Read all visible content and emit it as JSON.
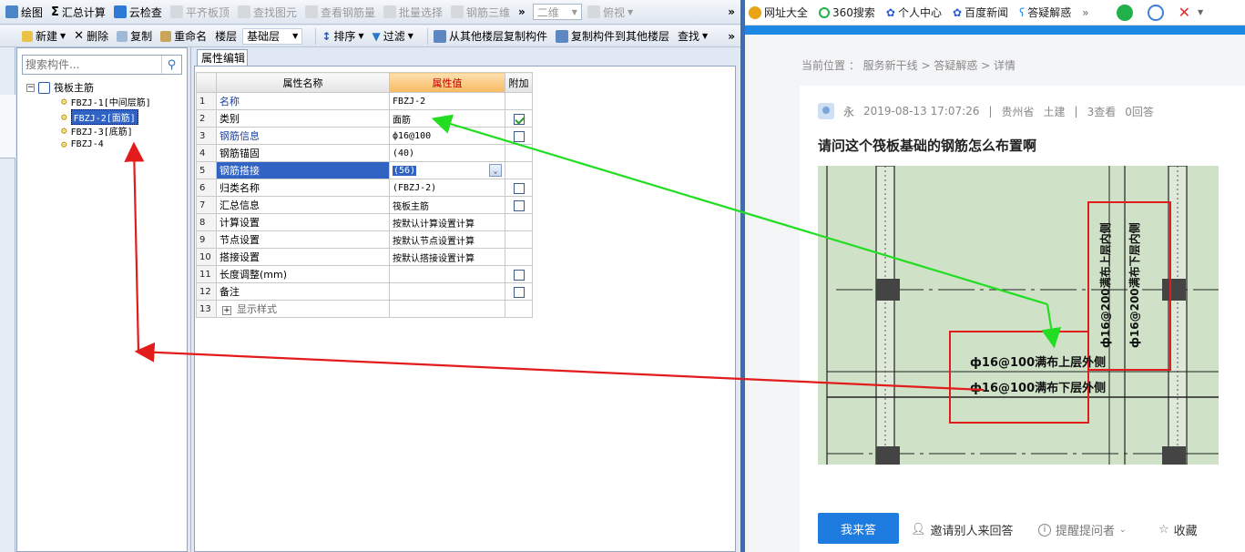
{
  "toolbar1": {
    "items": [
      {
        "label": "绘图",
        "icon": "draw-icon",
        "enabled": true
      },
      {
        "label": "汇总计算",
        "icon": "sigma-icon",
        "enabled": true
      },
      {
        "label": "云检查",
        "icon": "cloud-check-icon",
        "enabled": true
      },
      {
        "label": "平齐板顶",
        "icon": "align-top-icon",
        "enabled": false
      },
      {
        "label": "查找图元",
        "icon": "find-element-icon",
        "enabled": false
      },
      {
        "label": "查看钢筋量",
        "icon": "view-rebar-icon",
        "enabled": false
      },
      {
        "label": "批量选择",
        "icon": "batch-select-icon",
        "enabled": false
      },
      {
        "label": "钢筋三维",
        "icon": "rebar-3d-icon",
        "enabled": false
      }
    ],
    "view_mode": "二维",
    "view_angle": "俯视"
  },
  "toolbar2": {
    "new": "新建",
    "delete": "删除",
    "copy": "复制",
    "rename": "重命名",
    "floor_label": "楼层",
    "floor_value": "基础层",
    "sort": "排序",
    "filter": "过滤",
    "copy_from_other": "从其他楼层复制构件",
    "copy_to_other": "复制构件到其他楼层",
    "find": "查找"
  },
  "tree": {
    "search_placeholder": "搜索构件...",
    "root": "筏板主筋",
    "children": [
      "FBZJ-1[中间层筋]",
      "FBZJ-2[面筋]",
      "FBZJ-3[底筋]",
      "FBZJ-4"
    ],
    "selected_index": 1
  },
  "properties": {
    "tab": "属性编辑",
    "headers": {
      "name": "属性名称",
      "value": "属性值",
      "extra": "附加"
    },
    "rows": [
      {
        "no": "1",
        "name": "名称",
        "value": "FBZJ-2",
        "blue": true,
        "checkbox": null
      },
      {
        "no": "2",
        "name": "类别",
        "value": "面筋",
        "blue": false,
        "checkbox": true
      },
      {
        "no": "3",
        "name": "钢筋信息",
        "value": "ф16@100",
        "blue": true,
        "checkbox": false
      },
      {
        "no": "4",
        "name": "钢筋锚固",
        "value": "(40)",
        "blue": false,
        "checkbox": null
      },
      {
        "no": "5",
        "name": "钢筋搭接",
        "value": "(56)",
        "blue": false,
        "checkbox": null
      },
      {
        "no": "6",
        "name": "归类名称",
        "value": "(FBZJ-2)",
        "blue": false,
        "checkbox": false
      },
      {
        "no": "7",
        "name": "汇总信息",
        "value": "筏板主筋",
        "blue": false,
        "checkbox": false
      },
      {
        "no": "8",
        "name": "计算设置",
        "value": "按默认计算设置计算",
        "blue": false,
        "checkbox": null
      },
      {
        "no": "9",
        "name": "节点设置",
        "value": "按默认节点设置计算",
        "blue": false,
        "checkbox": null
      },
      {
        "no": "10",
        "name": "搭接设置",
        "value": "按默认搭接设置计算",
        "blue": false,
        "checkbox": null
      },
      {
        "no": "11",
        "name": "长度调整(mm)",
        "value": "",
        "blue": false,
        "checkbox": false
      },
      {
        "no": "12",
        "name": "备注",
        "value": "",
        "blue": false,
        "checkbox": false
      },
      {
        "no": "13",
        "name": "显示样式",
        "value": "",
        "blue": false,
        "checkbox": null
      }
    ],
    "selected_row": 4
  },
  "browser": {
    "bookmarks": [
      "网址大全",
      "360搜索",
      "个人中心",
      "百度新闻",
      "答疑解惑"
    ],
    "breadcrumb": "当前位置 ： 服务新干线 > 答疑解惑 > 详情",
    "author": "永",
    "datetime": "2019-08-13 17:07:26",
    "location": "贵州省",
    "category": "土建",
    "views": "3查看",
    "answers": "0回答",
    "question_title": "请问这个筏板基础的钢筋怎么布置啊",
    "drawing_labels": {
      "upper_outer": "ф16@100满布上层外侧",
      "lower_outer": "ф16@100满布下层外侧",
      "upper_inner": "ф16@200满布上层内侧",
      "lower_inner": "ф16@200满布下层内侧"
    },
    "answer_button": "我来答",
    "invite": "邀请别人来回答",
    "remind": "提醒提问者",
    "favorite": "收藏"
  },
  "colors": {
    "toolbar_bg": "#dfe6f0",
    "selection_blue": "#3163c5",
    "header_orange": "#f7b95f",
    "annot_green": "#22dd22",
    "annot_red": "#e21b1b",
    "answer_button": "#1e7be0"
  }
}
